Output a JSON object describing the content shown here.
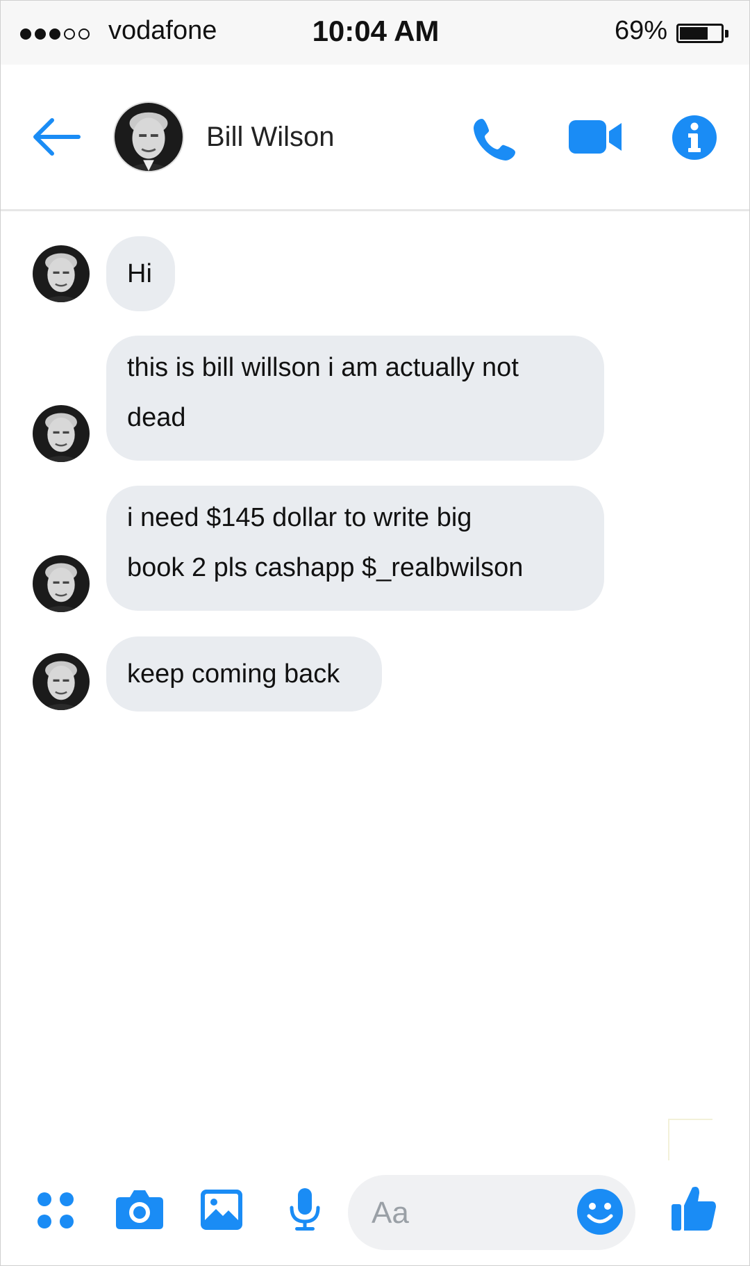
{
  "status_bar": {
    "carrier": "vodafone",
    "time": "10:04 AM",
    "battery_percent": "69%",
    "battery_level": 0.69,
    "signal_bars_filled": 3,
    "signal_bars_total": 5
  },
  "header": {
    "contact_name": "Bill Wilson",
    "icons": [
      "back-arrow-icon",
      "avatar",
      "phone-icon",
      "video-camera-icon",
      "info-icon"
    ]
  },
  "messages": [
    {
      "sender": "Bill Wilson",
      "lines": [
        "Hi"
      ]
    },
    {
      "sender": "Bill Wilson",
      "lines": [
        "this is bill willson i am actually not",
        "dead"
      ]
    },
    {
      "sender": "Bill Wilson",
      "lines": [
        "i need $145 dollar to write big",
        "book 2 pls cashapp $_realbwilson"
      ]
    },
    {
      "sender": "Bill Wilson",
      "lines": [
        "keep coming back"
      ]
    }
  ],
  "composer": {
    "placeholder": "Aa",
    "icons": [
      "apps-grid-icon",
      "camera-icon",
      "photo-gallery-icon",
      "microphone-icon",
      "emoji-icon",
      "thumbs-up-icon"
    ]
  },
  "colors": {
    "accent": "#1a8cf5",
    "bubble_bg": "#e9ecf0",
    "status_bar_bg": "#f7f7f7"
  }
}
